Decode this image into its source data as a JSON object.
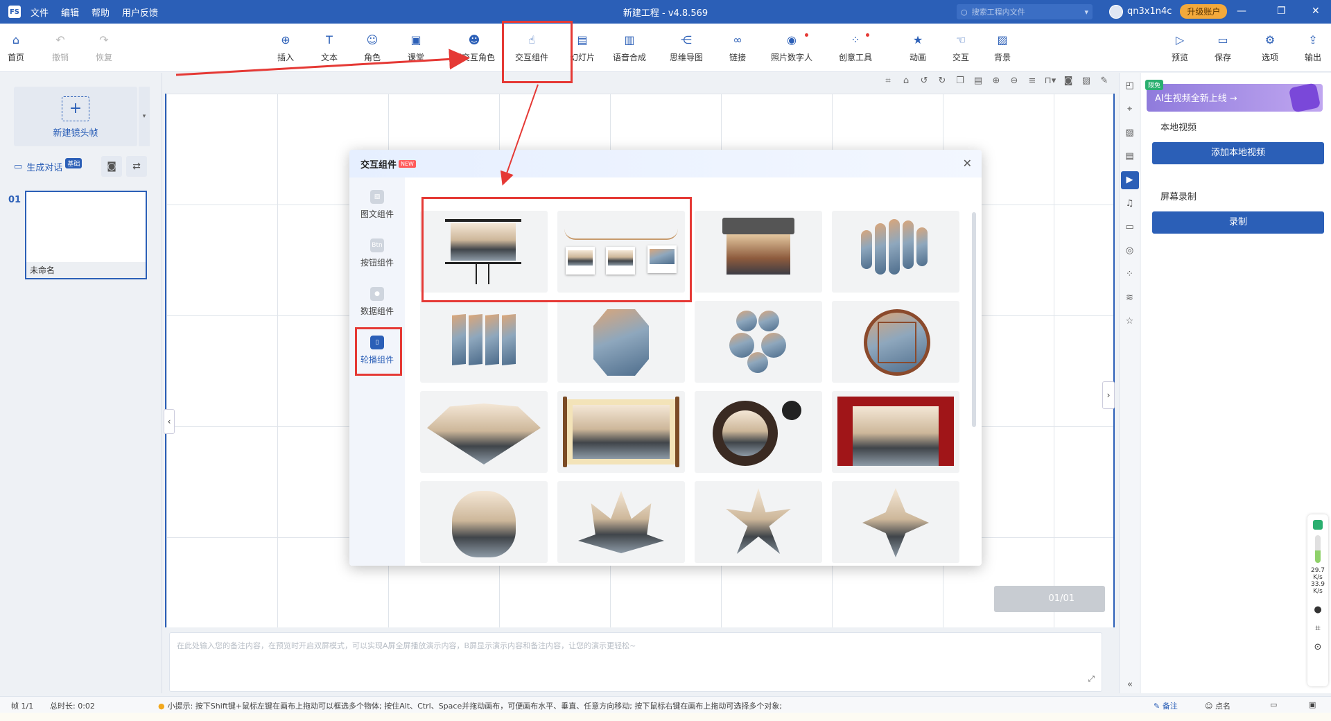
{
  "titlebar": {
    "logo": "FS",
    "menu": [
      "文件",
      "编辑",
      "帮助",
      "用户反馈"
    ],
    "title": "新建工程 - v4.8.569",
    "search_placeholder": "搜索工程内文件",
    "username": "qn3x1n4c",
    "upgrade": "升级账户"
  },
  "toolbar": {
    "left": [
      {
        "label": "首页",
        "icon": "home-icon",
        "enabled": true
      },
      {
        "label": "撤销",
        "icon": "undo-icon",
        "enabled": false
      },
      {
        "label": "恢复",
        "icon": "redo-icon",
        "enabled": false
      }
    ],
    "main": [
      {
        "label": "插入",
        "icon": "plus-circle-icon"
      },
      {
        "label": "文本",
        "icon": "text-icon"
      },
      {
        "label": "角色",
        "icon": "person-icon"
      },
      {
        "label": "课堂",
        "icon": "classroom-icon"
      },
      {
        "label": "互交互角色",
        "icon": "interactive-role-icon"
      },
      {
        "label": "交互组件",
        "icon": "interactive-component-icon"
      },
      {
        "label": "幻灯片",
        "icon": "slide-icon"
      },
      {
        "label": "语音合成",
        "icon": "voice-icon"
      },
      {
        "label": "思维导图",
        "icon": "mindmap-icon"
      },
      {
        "label": "链接",
        "icon": "link-icon"
      },
      {
        "label": "照片数字人",
        "icon": "photo-avatar-icon"
      },
      {
        "label": "创意工具",
        "icon": "creative-tools-icon"
      },
      {
        "label": "动画",
        "icon": "animation-icon"
      },
      {
        "label": "交互",
        "icon": "interaction-icon"
      },
      {
        "label": "背景",
        "icon": "background-icon"
      }
    ],
    "right": [
      {
        "label": "预览",
        "icon": "preview-icon"
      },
      {
        "label": "保存",
        "icon": "save-icon"
      },
      {
        "label": "选项",
        "icon": "options-icon"
      },
      {
        "label": "输出",
        "icon": "export-icon"
      }
    ]
  },
  "leftpanel": {
    "new_frame": "新建镜头帧",
    "gen_dialog": "生成对话",
    "gen_badge": "基础",
    "frame_number": "01",
    "frame_name": "未命名"
  },
  "canvas": {
    "page_indicator": "01/01"
  },
  "notes": {
    "placeholder": "在此处输入您的备注内容，在预览时开启双屏模式，可以实现A屏全屏播放演示内容，B屏显示演示内容和备注内容，让您的演示更轻松~"
  },
  "statusbar": {
    "frame": "帧 1/1",
    "duration": "总时长: 0:02",
    "hint": "小提示: 按下Shift键+鼠标左键在画布上拖动可以框选多个物体; 按住Alt、Ctrl、Space并拖动画布，可便画布水平、垂直、任意方向移动; 按下鼠标右键在画布上拖动可选择多个对象;",
    "notes_btn": "备注",
    "roll_btn": "点名"
  },
  "rightpanel": {
    "ai_badge": "限免",
    "ai_banner": "AI生视频全新上线 →",
    "local_video_title": "本地视频",
    "add_local_video": "添加本地视频",
    "screen_record_title": "屏幕录制",
    "record": "录制"
  },
  "float_widget": {
    "speed1": "29.7",
    "unit1": "K/s",
    "speed2": "33.9",
    "unit2": "K/s"
  },
  "modal": {
    "title": "交互组件",
    "new_badge": "NEW",
    "categories": [
      {
        "label": "图文组件",
        "icon": "image-text-icon"
      },
      {
        "label": "按钮组件",
        "icon": "button-icon",
        "icon_text": "Btn"
      },
      {
        "label": "数据组件",
        "icon": "data-icon"
      },
      {
        "label": "轮播组件",
        "icon": "carousel-icon",
        "active": true
      }
    ]
  },
  "colors": {
    "primary": "#2b5fb7",
    "annotation_red": "#e53935"
  }
}
